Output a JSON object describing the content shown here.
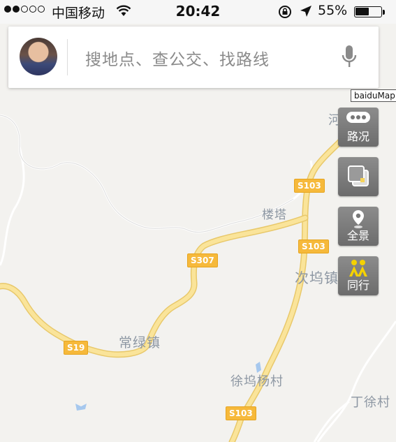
{
  "status_bar": {
    "carrier": "中国移动",
    "time": "20:42",
    "battery_percent_text": "55%",
    "battery_level": 0.55,
    "signal_bars_filled": 2,
    "signal_bars_total": 5
  },
  "search": {
    "placeholder": "搜地点、查公交、找路线"
  },
  "tooltip": "baiduMap",
  "controls": {
    "traffic_label": "路况",
    "layers_label": "",
    "panorama_label": "全景",
    "companion_label": "同行"
  },
  "map": {
    "places": [
      "河",
      "楼塔",
      "次坞镇",
      "常绿镇",
      "徐坞杨村",
      "丁徐村"
    ],
    "roads": [
      "S103",
      "S103",
      "S307",
      "S19",
      "S103"
    ]
  },
  "colors": {
    "road_fill": "#fae49a",
    "road_stroke": "#e8c86a",
    "badge": "#f6b93b",
    "label": "#8d97a3",
    "map_bg": "#f3f2ef",
    "control_bg": "#7b7b7b",
    "companion_icon": "#f5d200"
  }
}
